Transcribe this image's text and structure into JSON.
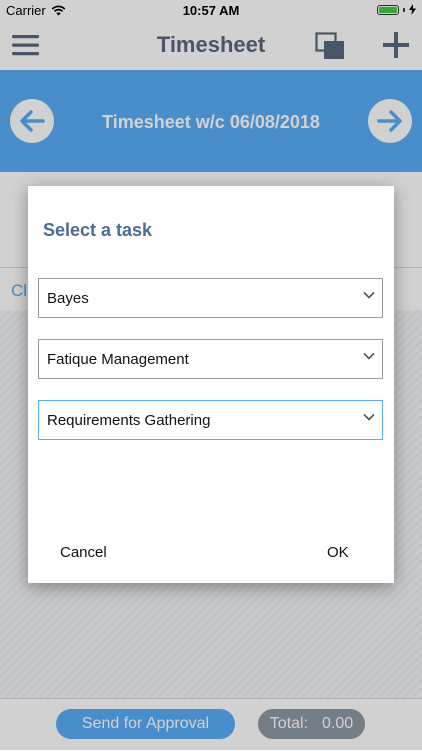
{
  "status_bar": {
    "carrier": "Carrier",
    "time": "10:57 AM"
  },
  "nav": {
    "title": "Timesheet",
    "menu_icon": "hamburger-icon",
    "copy_icon": "copy-icon",
    "add_icon": "plus-icon"
  },
  "week": {
    "title": "Timesheet w/c 06/08/2018",
    "prev_icon": "arrow-left-icon",
    "next_icon": "arrow-right-icon"
  },
  "background": {
    "partial_text": "Cl"
  },
  "footer": {
    "send_label": "Send for Approval",
    "total_label": "Total:",
    "total_value": "0.00"
  },
  "dialog": {
    "title": "Select a task",
    "selects": [
      {
        "value": "Bayes"
      },
      {
        "value": "Fatique Management"
      },
      {
        "value": "Requirements Gathering"
      }
    ],
    "cancel_label": "Cancel",
    "ok_label": "OK"
  },
  "colors": {
    "accent": "#5aaef7",
    "title_gray": "#5a6a7c",
    "dialog_title": "#4a6c95",
    "pill_gray": "#8e9aa5"
  }
}
